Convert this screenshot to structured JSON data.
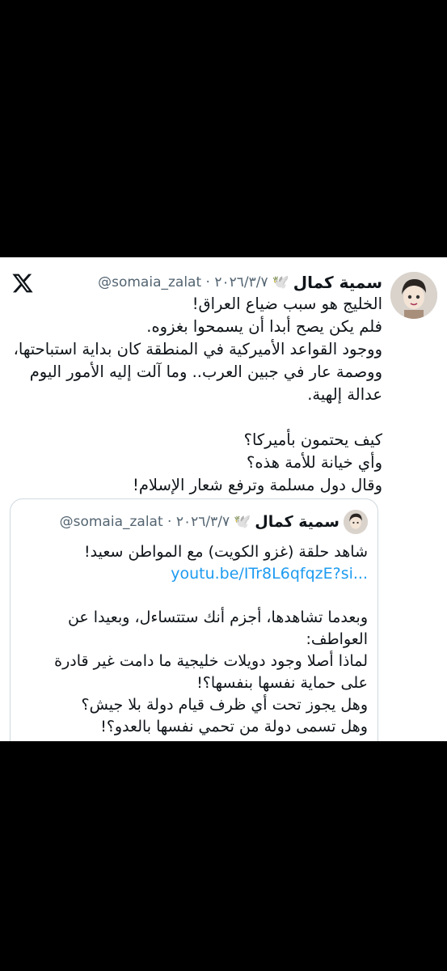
{
  "tweet": {
    "author_name": "سمية كمال",
    "author_emoji": "🕊️",
    "meta": "@somaia_zalat · ٢٠٢٦/٣/٧",
    "lines": [
      "الخليج هو سبب ضياع العراق!",
      "فلم يكن يصح أبدا أن يسمحوا بغزوه.",
      "ووجود القواعد الأميركية في المنطقة كان بداية استباحتها،",
      "ووصمة عار في جبين العرب.. وما آلت إليه الأمور اليوم",
      "عدالة إلهية.",
      "",
      "كيف يحتمون بأميركا؟",
      "وأي خيانة للأمة هذه؟",
      "وقال دول مسلمة وترفع شعار الإسلام!"
    ]
  },
  "quote": {
    "author_name": "سمية كمال",
    "author_emoji": "🕊️",
    "meta": "@somaia_zalat · ٢٠٢٦/٣/٧",
    "line1": "شاهد حلقة (غزو الكويت) مع المواطن سعيد!",
    "link": "youtu.be/ITr8L6qfqzE?si...",
    "lines": [
      "",
      "وبعدما تشاهدها، أجزم أنك ستتساءل، وبعيدا عن",
      "العواطف:",
      "لماذا أصلا وجود دويلات خليجية ما دامت غير قادرة",
      "على حماية نفسها بنفسها؟!",
      "وهل يجوز تحت أي ظرف قيام دولة بلا جيش؟",
      "وهل تسمى دولة من تحمي نفسها بالعدو؟!"
    ]
  },
  "icons": {
    "brand": "x-logo-icon",
    "avatar": "profile-avatar",
    "dove": "dove-emoji"
  },
  "colors": {
    "background": "#000000",
    "card": "#ffffff",
    "text": "#0f1419",
    "muted": "#536471",
    "link": "#1d9bf0"
  }
}
